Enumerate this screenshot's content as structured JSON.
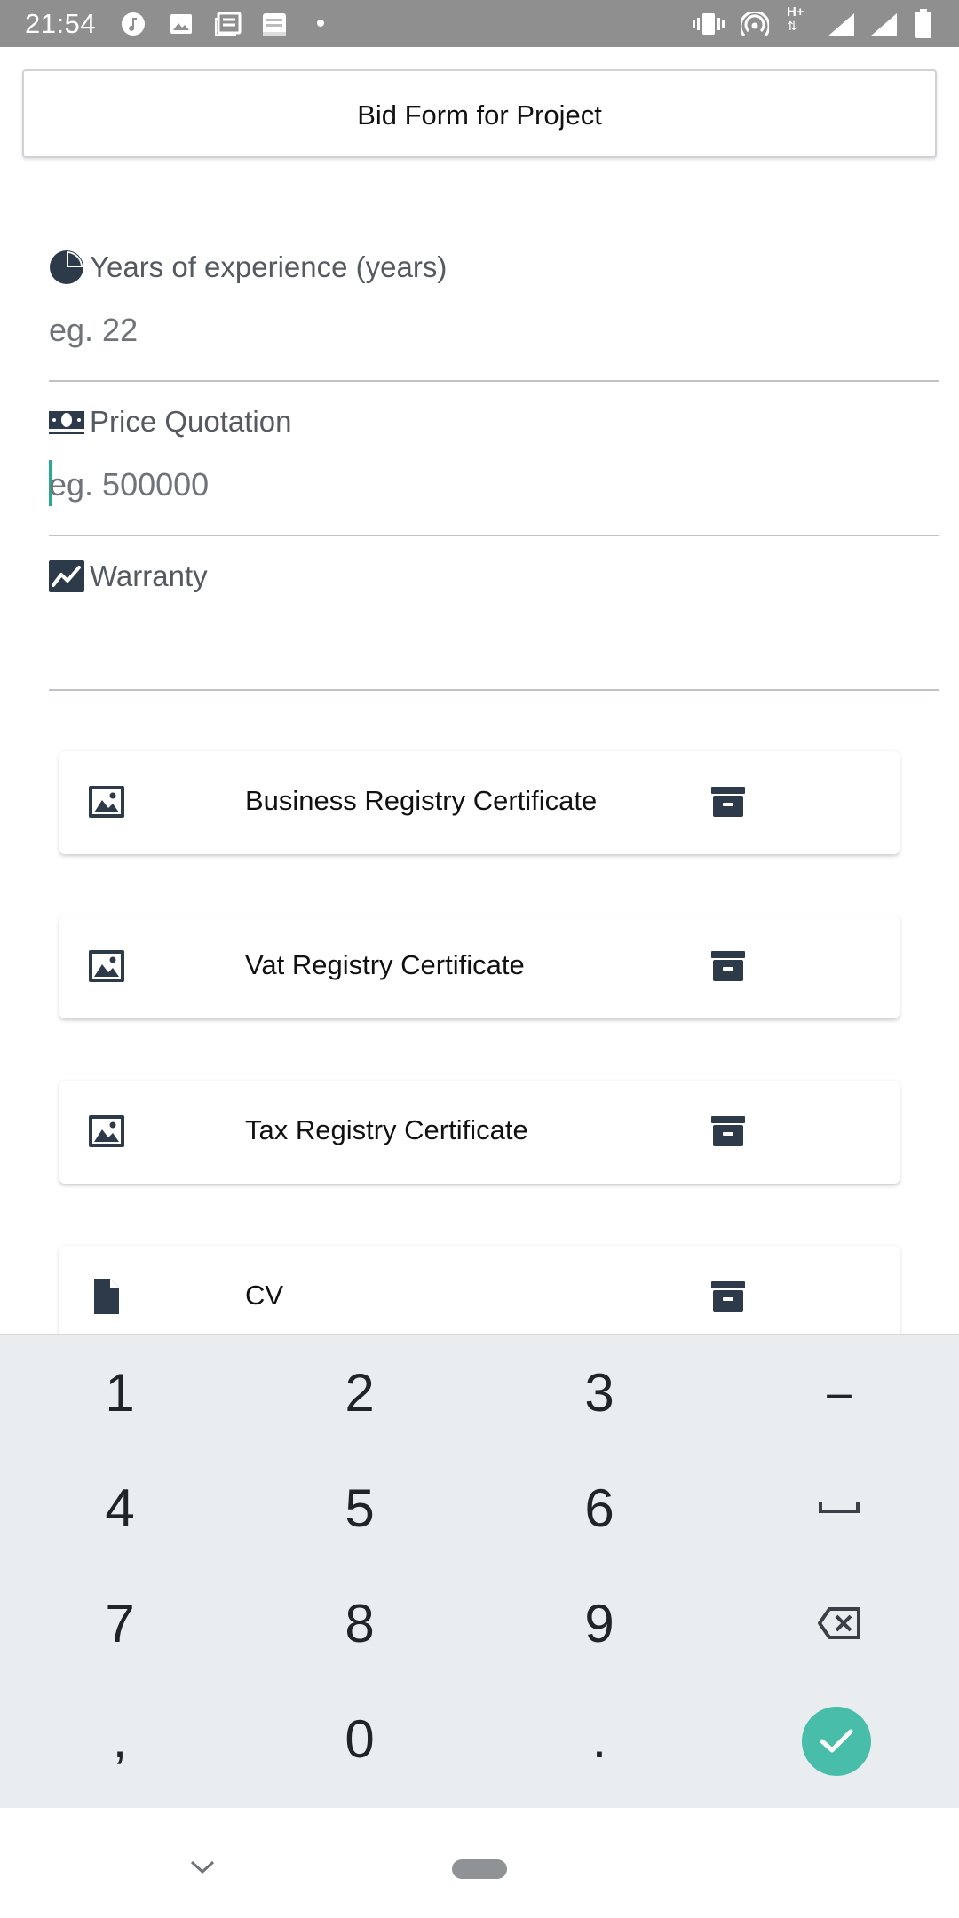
{
  "status_bar": {
    "time": "21:54",
    "left_icons": [
      "music-icon",
      "image-icon",
      "news-icon",
      "bible-icon",
      "dot-icon"
    ],
    "right_icons": [
      "vibrate-icon",
      "hotspot-icon",
      "h-plus-data-icon",
      "signal-icon",
      "signal-icon",
      "battery-icon"
    ],
    "network_label": "H+"
  },
  "header": {
    "title": "Bid Form for Project"
  },
  "form": {
    "fields": [
      {
        "icon": "pie-chart-icon",
        "label": "Years of experience (years)",
        "placeholder": "eg. 22",
        "value": ""
      },
      {
        "icon": "money-bill-icon",
        "label": "Price Quotation",
        "placeholder": "eg. 500000",
        "value": ""
      },
      {
        "icon": "chart-area-icon",
        "label": "Warranty",
        "placeholder": "",
        "value": ""
      }
    ]
  },
  "documents": [
    {
      "icon": "image-icon",
      "label": "Business Registry Certificate",
      "action_icon": "archive-icon"
    },
    {
      "icon": "image-icon",
      "label": "Vat Registry Certificate",
      "action_icon": "archive-icon"
    },
    {
      "icon": "image-icon",
      "label": "Tax Registry Certificate",
      "action_icon": "archive-icon"
    },
    {
      "icon": "file-icon",
      "label": "CV",
      "action_icon": "archive-icon"
    }
  ],
  "keyboard": {
    "rows": [
      [
        "1",
        "2",
        "3",
        "–"
      ],
      [
        "4",
        "5",
        "6",
        "␣"
      ],
      [
        "7",
        "8",
        "9",
        "⌫"
      ],
      [
        ",",
        "0",
        ".",
        "✓"
      ]
    ],
    "accent_color": "#48bda9"
  },
  "colors": {
    "status_bar": "#8f8f8f",
    "icon_dark": "#2d3a4a",
    "keyboard_bg": "#e9edf0",
    "caret": "#2aa892"
  }
}
